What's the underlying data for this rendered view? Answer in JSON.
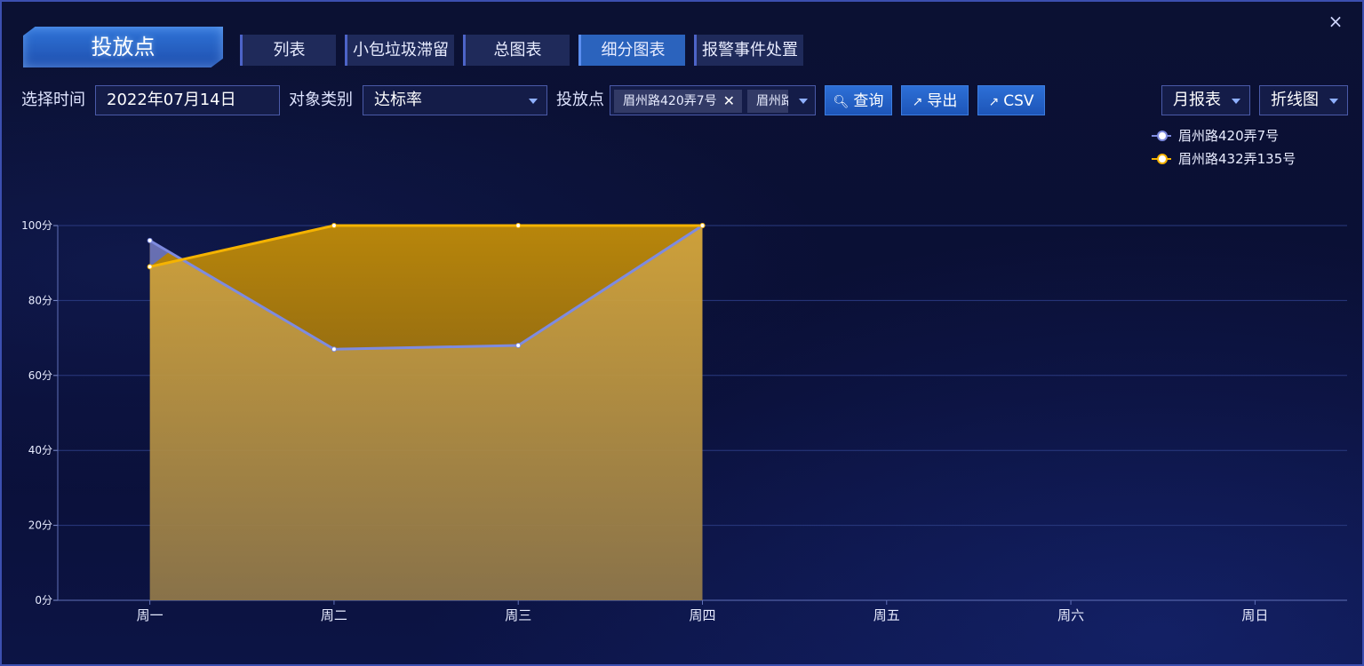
{
  "window": {
    "title": "投放点",
    "close_icon": "×"
  },
  "tabs": [
    {
      "label": "列表",
      "active": false
    },
    {
      "label": "小包垃圾滞留",
      "active": false
    },
    {
      "label": "总图表",
      "active": false
    },
    {
      "label": "细分图表",
      "active": true
    },
    {
      "label": "报警事件处置",
      "active": false
    }
  ],
  "filters": {
    "time_label": "选择时间",
    "time_value": "2022年07月14日",
    "type_label": "对象类别",
    "type_value": "达标率",
    "point_label": "投放点",
    "chips": [
      "眉州路420弄7号",
      "眉州路"
    ],
    "chip_close": "✕"
  },
  "buttons": {
    "query": "查询",
    "export": "导出",
    "csv": "CSV"
  },
  "dropdowns": {
    "report": "月报表",
    "chart_kind": "折线图"
  },
  "colors": {
    "accent": "#2b63bd",
    "series1": "#7e8be0",
    "series2": "#f5b300",
    "area": "#c8a043"
  },
  "chart_data": {
    "type": "line",
    "categories": [
      "周一",
      "周二",
      "周三",
      "周四",
      "周五",
      "周六",
      "周日"
    ],
    "series": [
      {
        "name": "眉州路420弄7号",
        "values": [
          96,
          67,
          68,
          100,
          null,
          null,
          null
        ]
      },
      {
        "name": "眉州路432弄135号",
        "values": [
          89,
          100,
          100,
          100,
          null,
          null,
          null
        ]
      }
    ],
    "yticks": [
      "0分",
      "20分",
      "40分",
      "60分",
      "80分",
      "100分"
    ],
    "ylim": [
      0,
      100
    ],
    "grid": true,
    "legend": "top-right"
  }
}
